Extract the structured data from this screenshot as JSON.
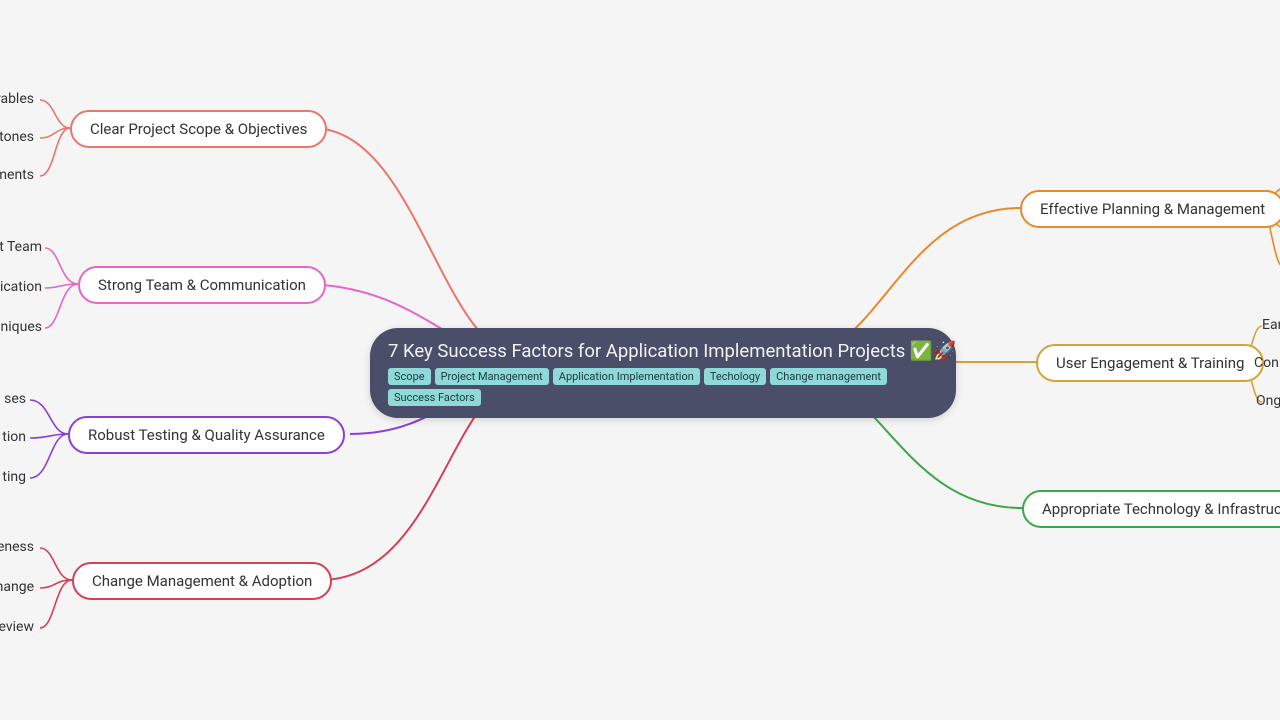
{
  "central": {
    "title": "7 Key Success Factors for Application Implementation Projects ✅🚀",
    "tags": [
      "Scope",
      "Project Management",
      "Application Implementation",
      "Techology",
      "Change management",
      "Success Factors"
    ]
  },
  "branches": {
    "clear_scope": {
      "label": "Clear Project Scope & Objectives",
      "color": "#e8766a",
      "leaves": [
        "rables",
        "stones",
        "ments"
      ]
    },
    "strong_team": {
      "label": "Strong Team & Communication",
      "color": "#e665c6",
      "leaves": [
        "ct Team",
        "ication",
        "nniques"
      ]
    },
    "robust_test": {
      "label": "Robust Testing & Quality Assurance",
      "color": "#8b3fd6",
      "leaves": [
        "ses",
        "tion",
        "ting"
      ]
    },
    "change_mgmt": {
      "label": "Change Management & Adoption",
      "color": "#d63f5a",
      "leaves": [
        "eness",
        "hange",
        "eview"
      ]
    },
    "effective_plan": {
      "label": "Effective Planning & Management",
      "color": "#e88a2a",
      "leaves": []
    },
    "user_eng": {
      "label": "User Engagement & Training",
      "color": "#d4a33a",
      "leaves": [
        "Earl",
        "Con",
        "Ong"
      ]
    },
    "appro_tech": {
      "label": "Appropriate Technology & Infrastructure",
      "color": "#3fa648",
      "leaves": []
    }
  }
}
